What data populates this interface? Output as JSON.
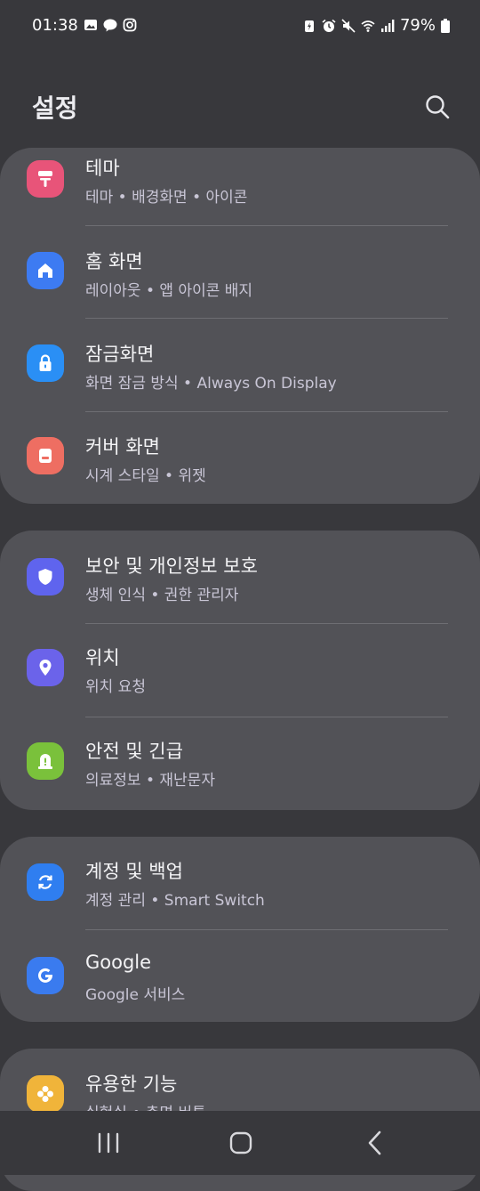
{
  "status": {
    "time": "01:38",
    "left_icons": [
      "gallery-icon",
      "talk-icon",
      "instagram-icon"
    ],
    "right_icons": [
      "battery-saver-icon",
      "alarm-icon",
      "mute-icon",
      "wifi-icon",
      "signal-icon"
    ],
    "battery": "79%"
  },
  "header": {
    "title": "설정",
    "search_icon": "search-icon"
  },
  "colors": {
    "background": "#38383c",
    "card": "#525257",
    "subtitle": "#c9c6d6"
  },
  "groups": [
    {
      "items": [
        {
          "title": "테마",
          "subtitle": "테마 • 배경화면 • 아이콘",
          "icon": "theme-icon",
          "icon_color": "#e85479"
        },
        {
          "title": "홈 화면",
          "subtitle": "레이아웃 • 앱 아이콘 배지",
          "icon": "home-icon",
          "icon_color": "#3d7bf2"
        },
        {
          "title": "잠금화면",
          "subtitle": "화면 잠금 방식 • Always On Display",
          "icon": "lock-icon",
          "icon_color": "#2a8ff5"
        },
        {
          "title": "커버 화면",
          "subtitle": "시계 스타일 • 위젯",
          "icon": "cover-screen-icon",
          "icon_color": "#ee6e62"
        }
      ]
    },
    {
      "items": [
        {
          "title": "보안 및 개인정보 보호",
          "subtitle": "생체 인식 • 권한 관리자",
          "icon": "shield-icon",
          "icon_color": "#5f64ee"
        },
        {
          "title": "위치",
          "subtitle": "위치 요청",
          "icon": "location-pin-icon",
          "icon_color": "#6b63ea"
        },
        {
          "title": "안전 및 긴급",
          "subtitle": "의료정보 • 재난문자",
          "icon": "emergency-icon",
          "icon_color": "#7ac13b"
        }
      ]
    },
    {
      "items": [
        {
          "title": "계정 및 백업",
          "subtitle": "계정 관리 • Smart Switch",
          "icon": "sync-icon",
          "icon_color": "#2f7ef0"
        },
        {
          "title": "Google",
          "subtitle": "Google 서비스",
          "icon": "google-icon",
          "icon_color": "#3a7bef"
        }
      ]
    },
    {
      "items": [
        {
          "title": "유용한 기능",
          "subtitle": "실험실 • 측면 버튼",
          "icon": "advanced-features-icon",
          "icon_color": "#f0b43a"
        }
      ]
    }
  ],
  "navbar": {
    "recents_icon": "recents-icon",
    "home_icon": "home-nav-icon",
    "back_icon": "back-icon"
  }
}
